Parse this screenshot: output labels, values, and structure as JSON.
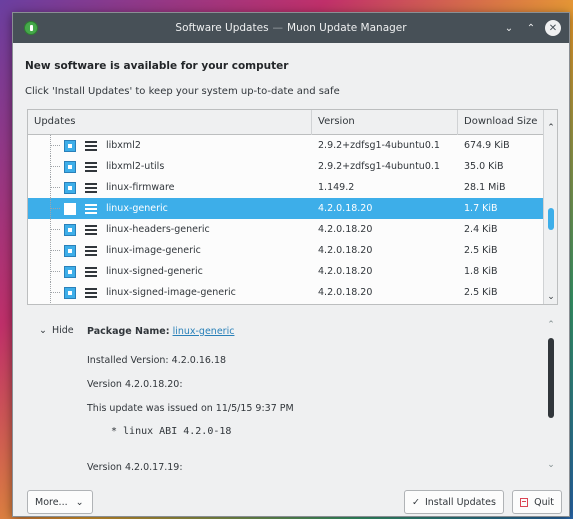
{
  "window": {
    "title": "Software Updates",
    "separator": "—",
    "app_name": "Muon Update Manager",
    "controls": {
      "minimize": "⌄",
      "maximize": "⌃",
      "close": "✕"
    }
  },
  "header": {
    "headline": "New software is available for your computer",
    "subline": "Click 'Install Updates' to keep your system up-to-date and safe"
  },
  "table": {
    "columns": [
      "Updates",
      "Version",
      "Download Size"
    ],
    "rows": [
      {
        "name": "libxml2",
        "version": "2.9.2+zdfsg1-4ubuntu0.1",
        "size": "674.9 KiB",
        "checked": true,
        "selected": false
      },
      {
        "name": "libxml2-utils",
        "version": "2.9.2+zdfsg1-4ubuntu0.1",
        "size": "35.0 KiB",
        "checked": true,
        "selected": false
      },
      {
        "name": "linux-firmware",
        "version": "1.149.2",
        "size": "28.1 MiB",
        "checked": true,
        "selected": false
      },
      {
        "name": "linux-generic",
        "version": "4.2.0.18.20",
        "size": "1.7 KiB",
        "checked": true,
        "selected": true
      },
      {
        "name": "linux-headers-generic",
        "version": "4.2.0.18.20",
        "size": "2.4 KiB",
        "checked": true,
        "selected": false
      },
      {
        "name": "linux-image-generic",
        "version": "4.2.0.18.20",
        "size": "2.5 KiB",
        "checked": true,
        "selected": false
      },
      {
        "name": "linux-signed-generic",
        "version": "4.2.0.18.20",
        "size": "1.8 KiB",
        "checked": true,
        "selected": false
      },
      {
        "name": "linux-signed-image-generic",
        "version": "4.2.0.18.20",
        "size": "2.5 KiB",
        "checked": true,
        "selected": false
      }
    ]
  },
  "details": {
    "hide_label": "Hide",
    "package_name_label": "Package Name:",
    "package_name": "linux-generic",
    "installed_version": "Installed Version: 4.2.0.16.18",
    "version_heading": "Version 4.2.0.18.20:",
    "issued": "This update was issued on 11/5/15 9:37 PM",
    "changelog_line": "* linux ABI 4.2.0-18",
    "version_heading_2": "Version 4.2.0.17.19:"
  },
  "buttons": {
    "more": "More...",
    "install": "Install Updates",
    "quit": "Quit"
  }
}
